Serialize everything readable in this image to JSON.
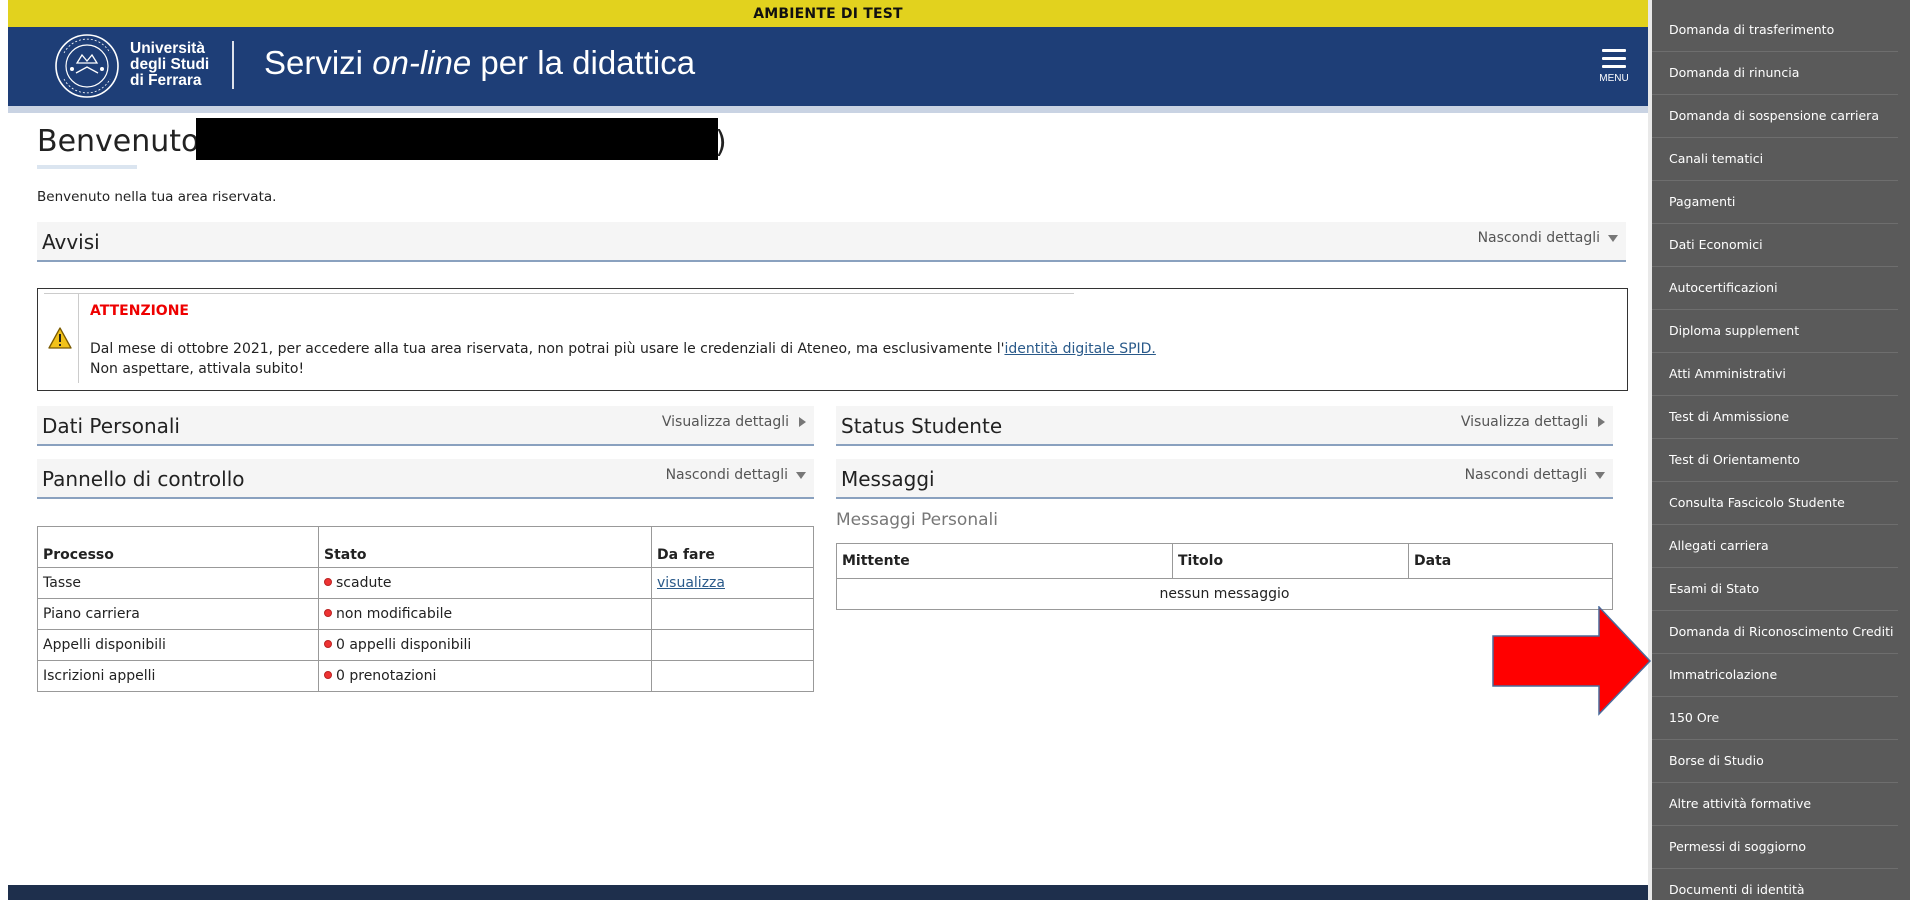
{
  "banner": {
    "text": "AMBIENTE DI TEST"
  },
  "header": {
    "university_line1": "Università",
    "university_line2": "degli Studi",
    "university_line3": "di Ferrara",
    "title_part1": "Servizi ",
    "title_italic": "on-line",
    "title_part2": " per la didattica",
    "menu_label": "MENU"
  },
  "welcome": {
    "heading": "Benvenuto",
    "heading_tail": ")",
    "subtitle": "Benvenuto nella tua area riservata."
  },
  "avvisi": {
    "title": "Avvisi",
    "toggle": "Nascondi dettagli",
    "alert_title": "ATTENZIONE",
    "alert_text": "Dal mese di ottobre 2021, per accedere alla tua area riservata, non potrai più usare le credenziali di Ateneo, ma esclusivamente l'",
    "alert_link": "identità digitale SPID.",
    "alert_text2": "Non aspettare, attivala subito!"
  },
  "dati_personali": {
    "title": "Dati Personali",
    "toggle": "Visualizza dettagli"
  },
  "status_studente": {
    "title": "Status Studente",
    "toggle": "Visualizza dettagli"
  },
  "pannello": {
    "title": "Pannello di controllo",
    "toggle": "Nascondi dettagli",
    "headers": [
      "Processo",
      "Stato",
      "Da fare"
    ],
    "rows": [
      {
        "processo": "Tasse",
        "stato": "scadute",
        "da_fare": "visualizza"
      },
      {
        "processo": "Piano carriera",
        "stato": "non modificabile",
        "da_fare": ""
      },
      {
        "processo": "Appelli disponibili",
        "stato": "0 appelli disponibili",
        "da_fare": ""
      },
      {
        "processo": "Iscrizioni appelli",
        "stato": "0 prenotazioni",
        "da_fare": ""
      }
    ]
  },
  "messaggi": {
    "title": "Messaggi",
    "toggle": "Nascondi dettagli",
    "subtitle": "Messaggi Personali",
    "headers": [
      "Mittente",
      "Titolo",
      "Data"
    ],
    "empty": "nessun messaggio"
  },
  "side_menu": {
    "items": [
      "Domanda di trasferimento",
      "Domanda di rinuncia",
      "Domanda di sospensione carriera",
      "Canali tematici",
      "Pagamenti",
      "Dati Economici",
      "Autocertificazioni",
      "Diploma supplement",
      "Atti Amministrativi",
      "Test di Ammissione",
      "Test di Orientamento",
      "Consulta Fascicolo Studente",
      "Allegati carriera",
      "Esami di Stato",
      "Domanda di Riconoscimento Crediti",
      "Immatricolazione",
      "150 Ore",
      "Borse di Studio",
      "Altre attività formative",
      "Permessi di soggiorno",
      "Documenti di identità"
    ]
  },
  "colors": {
    "banner": "#e2d21e",
    "header": "#1e3e77",
    "side_menu": "#5a5a5a",
    "alert_title": "#ee0000",
    "arrow": "#ff0000"
  }
}
